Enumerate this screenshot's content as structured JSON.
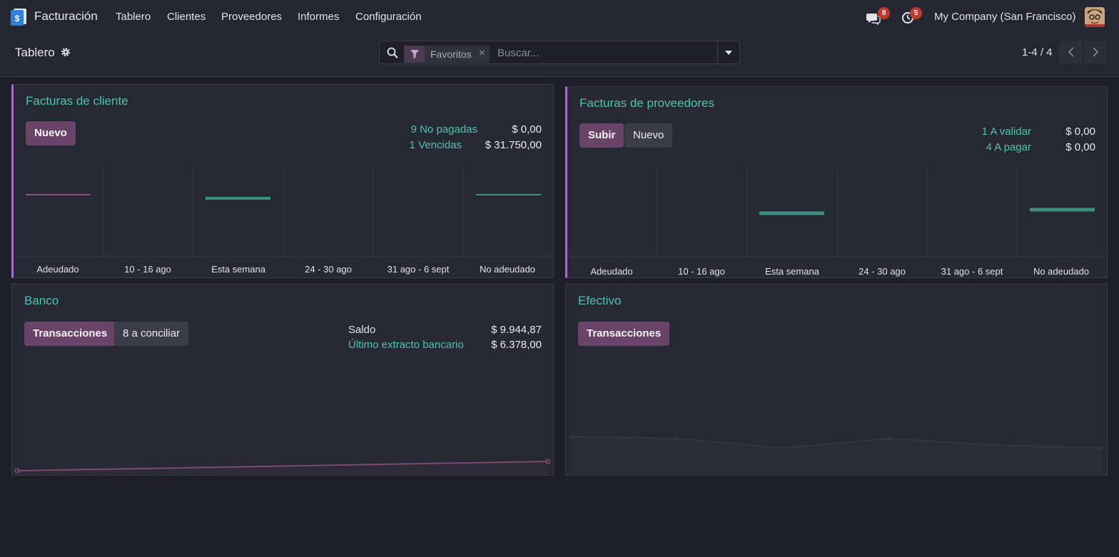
{
  "navbar": {
    "app_title": "Facturación",
    "menu": [
      "Tablero",
      "Clientes",
      "Proveedores",
      "Informes",
      "Configuración"
    ],
    "messages_badge": "8",
    "activities_badge": "5",
    "company": "My Company (San Francisco)"
  },
  "control_panel": {
    "title": "Tablero",
    "facet_label": "Favoritos",
    "facet_close": "×",
    "search_placeholder": "Buscar...",
    "pager": "1-4 / 4"
  },
  "cards": {
    "customer_invoices": {
      "title": "Facturas de cliente",
      "new_button": "Nuevo",
      "stats": [
        {
          "label": "9 No pagadas",
          "value": "$ 0,00"
        },
        {
          "label": "1 Vencidas",
          "value": "$ 31.750,00"
        }
      ],
      "chart_labels": [
        "Adeudado",
        "10 - 16 ago",
        "Esta semana",
        "24 - 30 ago",
        "31 ago - 6 sept",
        "No adeudado"
      ]
    },
    "vendor_bills": {
      "title": "Facturas de proveedores",
      "upload_button": "Subir",
      "new_button": "Nuevo",
      "stats": [
        {
          "label": "1 A validar",
          "value": "$ 0,00"
        },
        {
          "label": "4 A pagar",
          "value": "$ 0,00"
        }
      ],
      "chart_labels": [
        "Adeudado",
        "10 - 16 ago",
        "Esta semana",
        "24 - 30 ago",
        "31 ago - 6 sept",
        "No adeudado"
      ]
    },
    "bank": {
      "title": "Banco",
      "transactions_button": "Transacciones",
      "reconcile_button": "8 a conciliar",
      "balance_label": "Saldo",
      "balance_value": "$ 9.944,87",
      "statement_label": "Último extracto bancario",
      "statement_value": "$ 6.378,00"
    },
    "cash": {
      "title": "Efectivo",
      "transactions_button": "Transacciones"
    }
  },
  "colors": {
    "accent_teal": "#4fc3b0",
    "accent_purple": "#a36fc7",
    "primary_button": "#6a4468",
    "background": "#1e1f29"
  }
}
